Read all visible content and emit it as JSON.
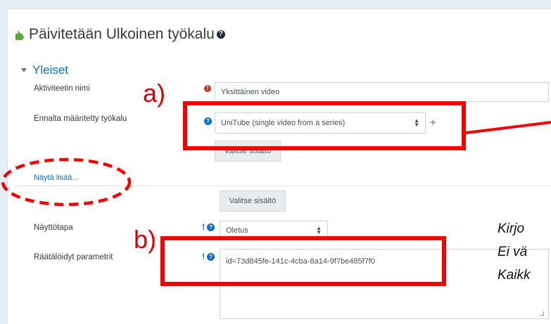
{
  "heading": {
    "title": "Päivitetään Ulkoinen työkalu",
    "help_glyph": "?"
  },
  "section": {
    "title": "Yleiset"
  },
  "fields": {
    "activity_name": {
      "label": "Aktiviteetin nimi",
      "value": "Yksittäinen video"
    },
    "preconfigured_tool": {
      "label": "Ennalta määritetty työkalu",
      "value": "UniTube (single video from a series)"
    },
    "select_content_1": "Valitse sisältö",
    "show_more": "Näytä lisää...",
    "select_content_2": "Valitse sisältö",
    "launch_container": {
      "label": "Näyttötapa",
      "value": "Oletus"
    },
    "custom_parameters": {
      "label": "Räätälöidyt parametrit",
      "value": "id=73d845fe-141c-4cba-8a14-9f7be485f7f0"
    }
  },
  "annotations": {
    "a_label": "a)",
    "b_label": "b)",
    "side_lines": [
      "Kirjo",
      "Ei vä",
      "Kaikk"
    ],
    "color": "#f70000"
  },
  "colors": {
    "link": "#0f6fc5",
    "required": "#c0392b",
    "background": "#e4edf6"
  }
}
